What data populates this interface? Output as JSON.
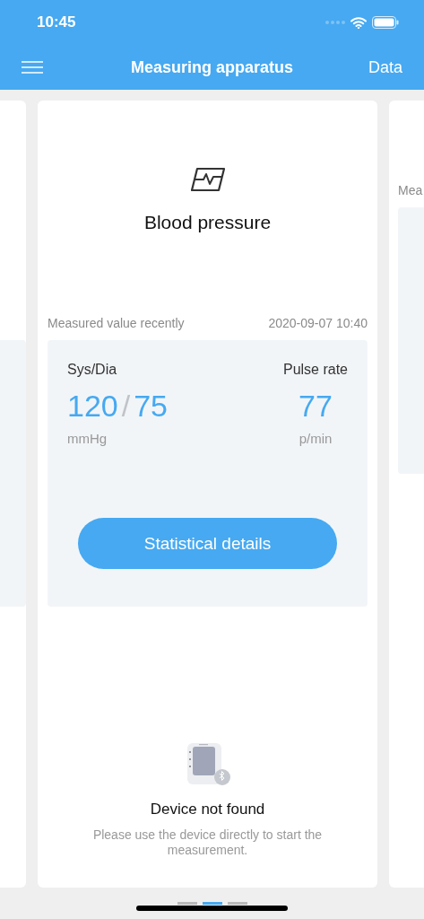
{
  "status_bar": {
    "time": "10:45"
  },
  "nav": {
    "title": "Measuring apparatus",
    "action": "Data"
  },
  "card": {
    "title": "Blood pressure",
    "recent_label": "Measured value recently",
    "recent_time": "2020-09-07 10:40",
    "sys_label": "Sys/Dia",
    "sys": "120",
    "separator": "/",
    "dia": "75",
    "bp_unit": "mmHg",
    "pulse_label": "Pulse rate",
    "pulse": "77",
    "pulse_unit": "p/min",
    "button": "Statistical details",
    "device_title": "Device not found",
    "device_text": "Please use the device directly to start the measurement."
  },
  "next_card": {
    "recent_label": "Mea"
  },
  "pages": [
    {
      "selected": false
    },
    {
      "selected": true
    },
    {
      "selected": false
    }
  ]
}
